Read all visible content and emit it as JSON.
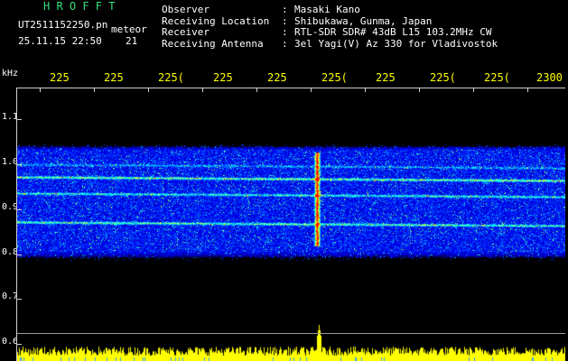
{
  "header": {
    "brand": "H R O F F T",
    "filename": "UT2511152250.pn",
    "meteor_label": "meteor",
    "timestamp": "25.11.15 22:50",
    "count": "21"
  },
  "info": [
    {
      "key": "Observer",
      "sep": ":",
      "value": "Masaki Kano"
    },
    {
      "key": "Receiving Location",
      "sep": ":",
      "value": "Shibukawa, Gunma, Japan"
    },
    {
      "key": "Receiver",
      "sep": ":",
      "value": "RTL-SDR SDR# 43dB L15 103.2MHz CW"
    },
    {
      "key": "Receiving Antenna",
      "sep": ":",
      "value": "3el Yagi(V) Az 330 for Vladivostok"
    }
  ],
  "axes": {
    "y_unit": "kHz",
    "y_ticks": [
      "1.1",
      "1.0",
      "0.9",
      "0.8",
      "0.7",
      "0.6"
    ],
    "x_ticks": [
      "225",
      "225",
      "225(",
      "225",
      "225",
      "225(",
      "225",
      "225(",
      "225(",
      "2300"
    ]
  },
  "colors": {
    "background": "#000000",
    "brand": "#36e07a",
    "axis_text": "#ffffff",
    "x_tick_text": "#ffff00",
    "noise_bar": "#ffff00",
    "frame": "#cfcfcf"
  }
}
